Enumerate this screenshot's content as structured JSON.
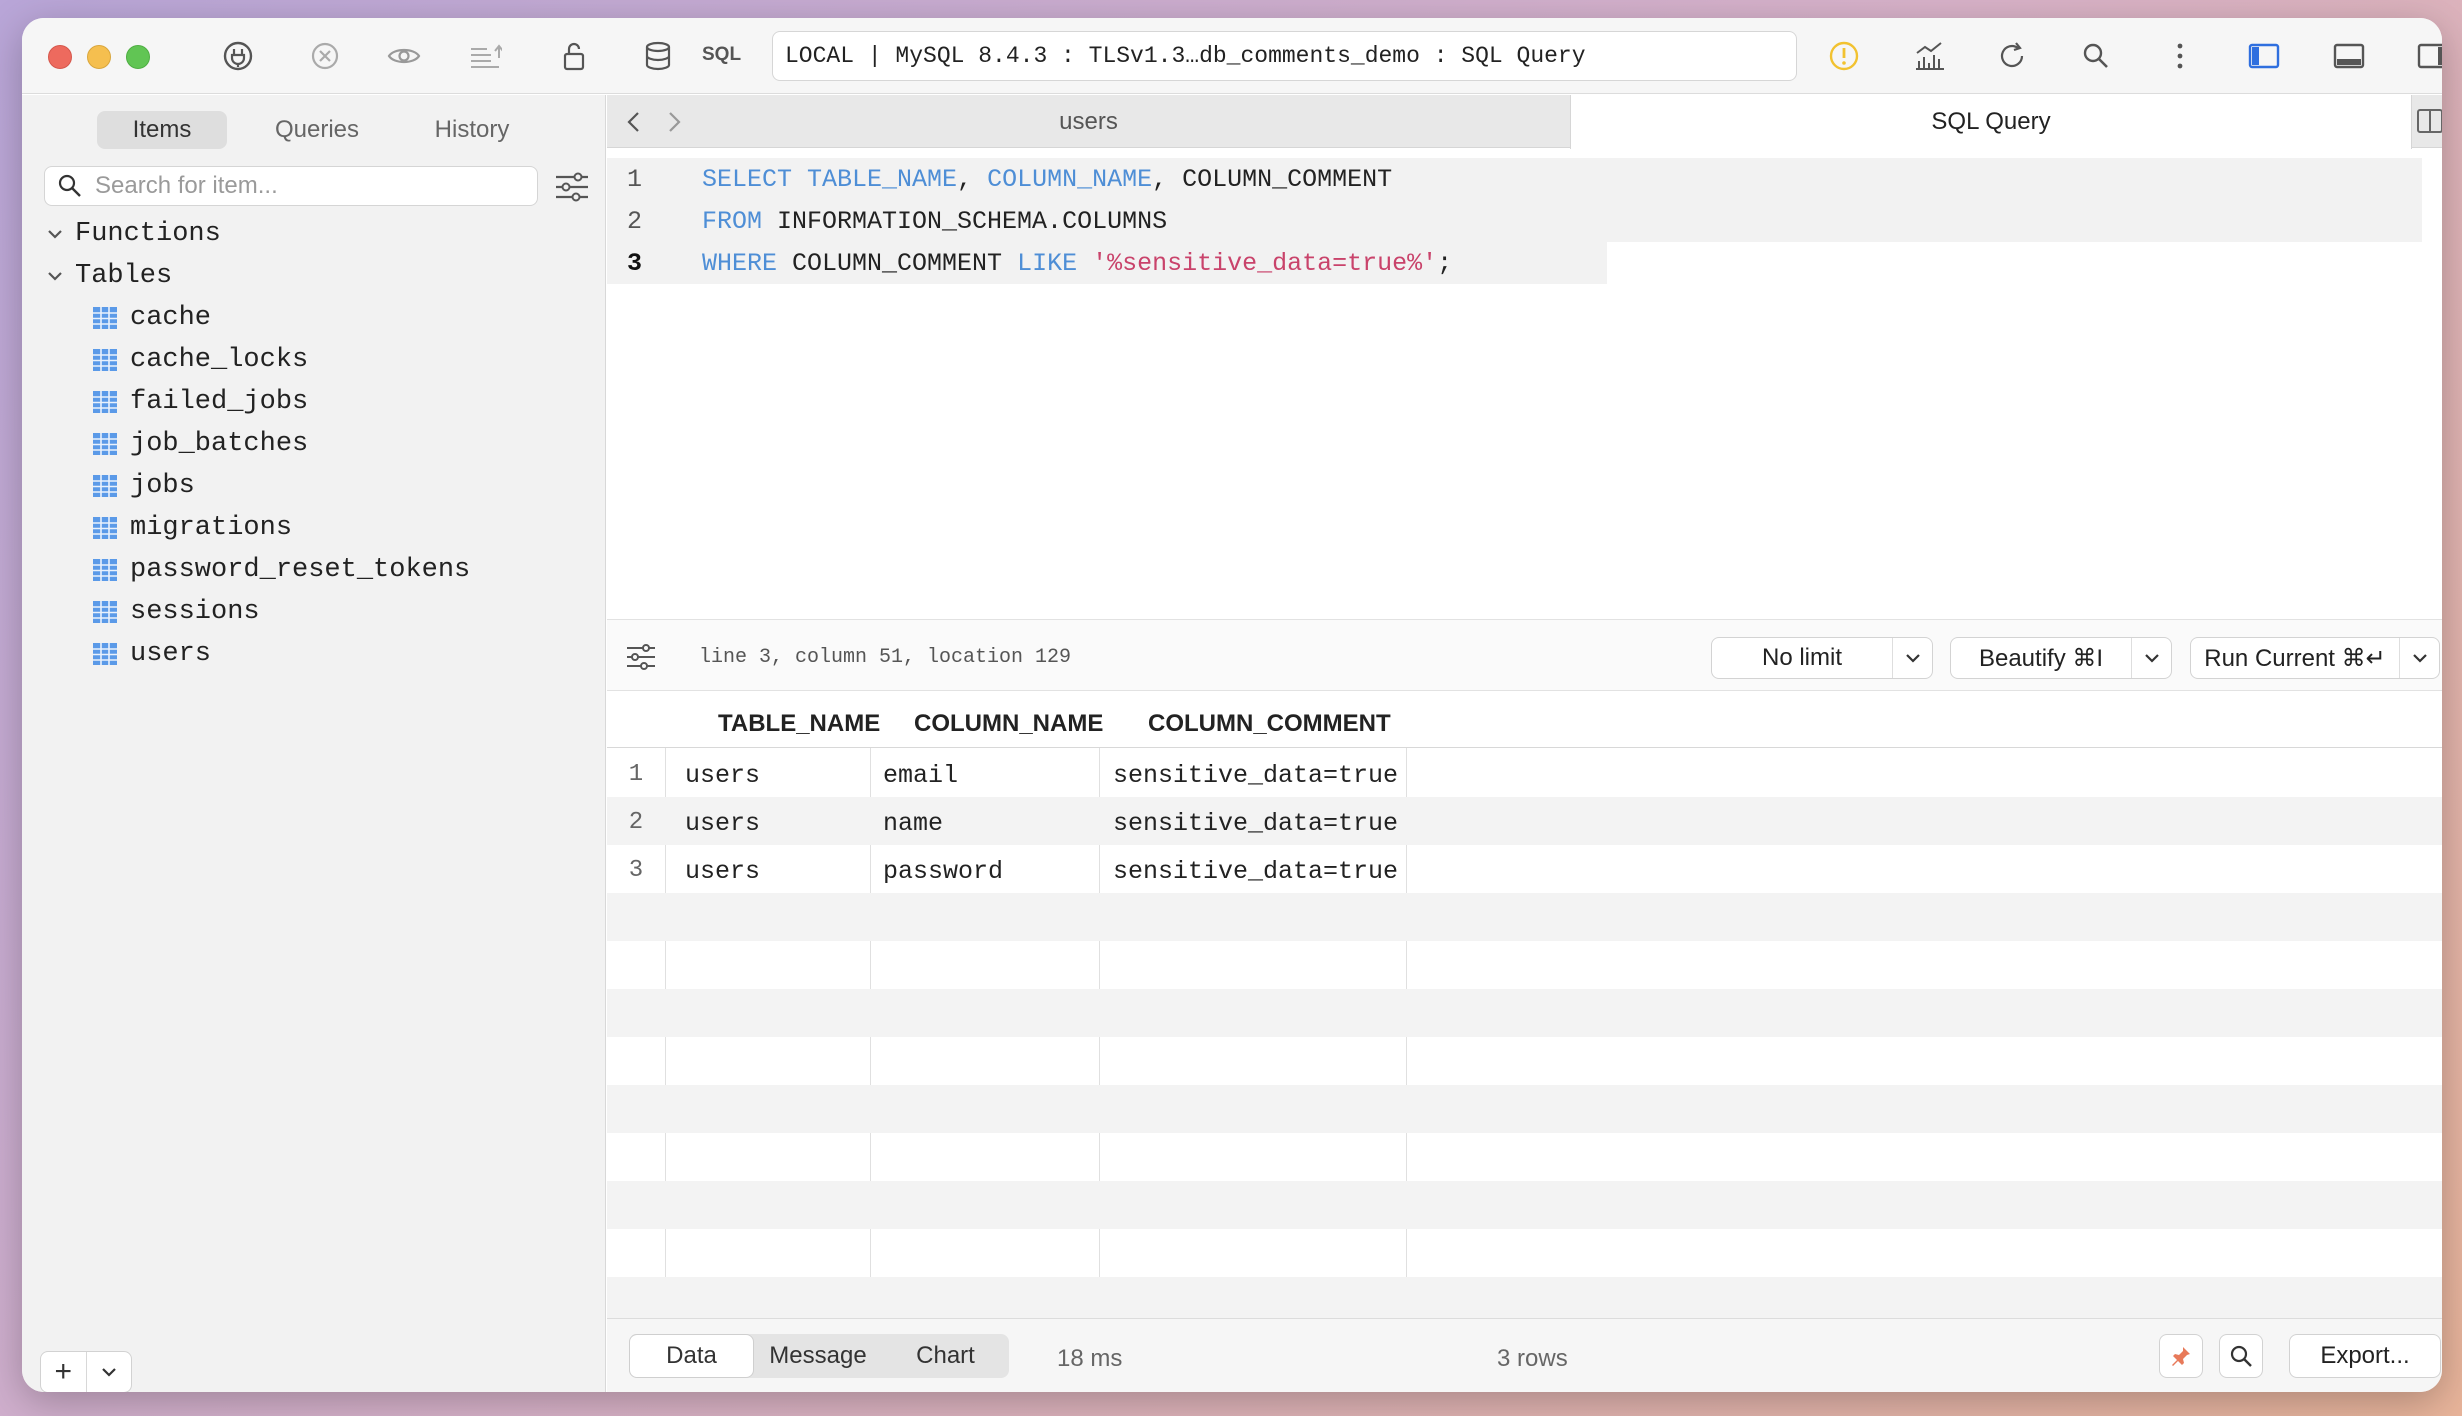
{
  "toolbar": {
    "sql_label": "SQL",
    "connection": "LOCAL | MySQL 8.4.3 : TLSv1.3…db_comments_demo : SQL Query",
    "warning_color": "#f2c230",
    "active_color": "#2f6fdf"
  },
  "sidebar": {
    "tabs": [
      {
        "label": "Items",
        "active": true
      },
      {
        "label": "Queries",
        "active": false
      },
      {
        "label": "History",
        "active": false
      }
    ],
    "search_placeholder": "Search for item...",
    "groups": {
      "functions": "Functions",
      "tables": "Tables"
    },
    "tables": [
      "cache",
      "cache_locks",
      "failed_jobs",
      "job_batches",
      "jobs",
      "migrations",
      "password_reset_tokens",
      "sessions",
      "users"
    ],
    "add_label": "+"
  },
  "tabs": {
    "inactive": "users",
    "active": "SQL Query"
  },
  "editor": {
    "line_numbers": [
      "1",
      "2",
      "3"
    ],
    "line1": {
      "t1": "SELECT",
      "t2": " ",
      "t3": "TABLE_NAME",
      "t4": ", ",
      "t5": "COLUMN_NAME",
      "t6": ", COLUMN_COMMENT"
    },
    "line2": {
      "t1": "FROM",
      "t2": " INFORMATION_SCHEMA.COLUMNS"
    },
    "line3": {
      "t1": "WHERE",
      "t2": " COLUMN_COMMENT ",
      "t3": "LIKE",
      "t4": " ",
      "t5": "'%sensitive_data=true%'",
      "t6": ";"
    }
  },
  "status": {
    "position": "line 3, column 51, location 129",
    "limit": "No limit",
    "beautify": "Beautify ⌘I",
    "run": "Run Current ⌘↵"
  },
  "results": {
    "columns": [
      "TABLE_NAME",
      "COLUMN_NAME",
      "COLUMN_COMMENT"
    ],
    "rows": [
      {
        "num": "1",
        "table_name": "users",
        "column_name": "email",
        "column_comment": "sensitive_data=true"
      },
      {
        "num": "2",
        "table_name": "users",
        "column_name": "name",
        "column_comment": "sensitive_data=true"
      },
      {
        "num": "3",
        "table_name": "users",
        "column_name": "password",
        "column_comment": "sensitive_data=true"
      }
    ]
  },
  "bottom": {
    "tabs": [
      "Data",
      "Message",
      "Chart"
    ],
    "active_tab": "Data",
    "timing": "18 ms",
    "row_count": "3 rows",
    "export_label": "Export..."
  }
}
